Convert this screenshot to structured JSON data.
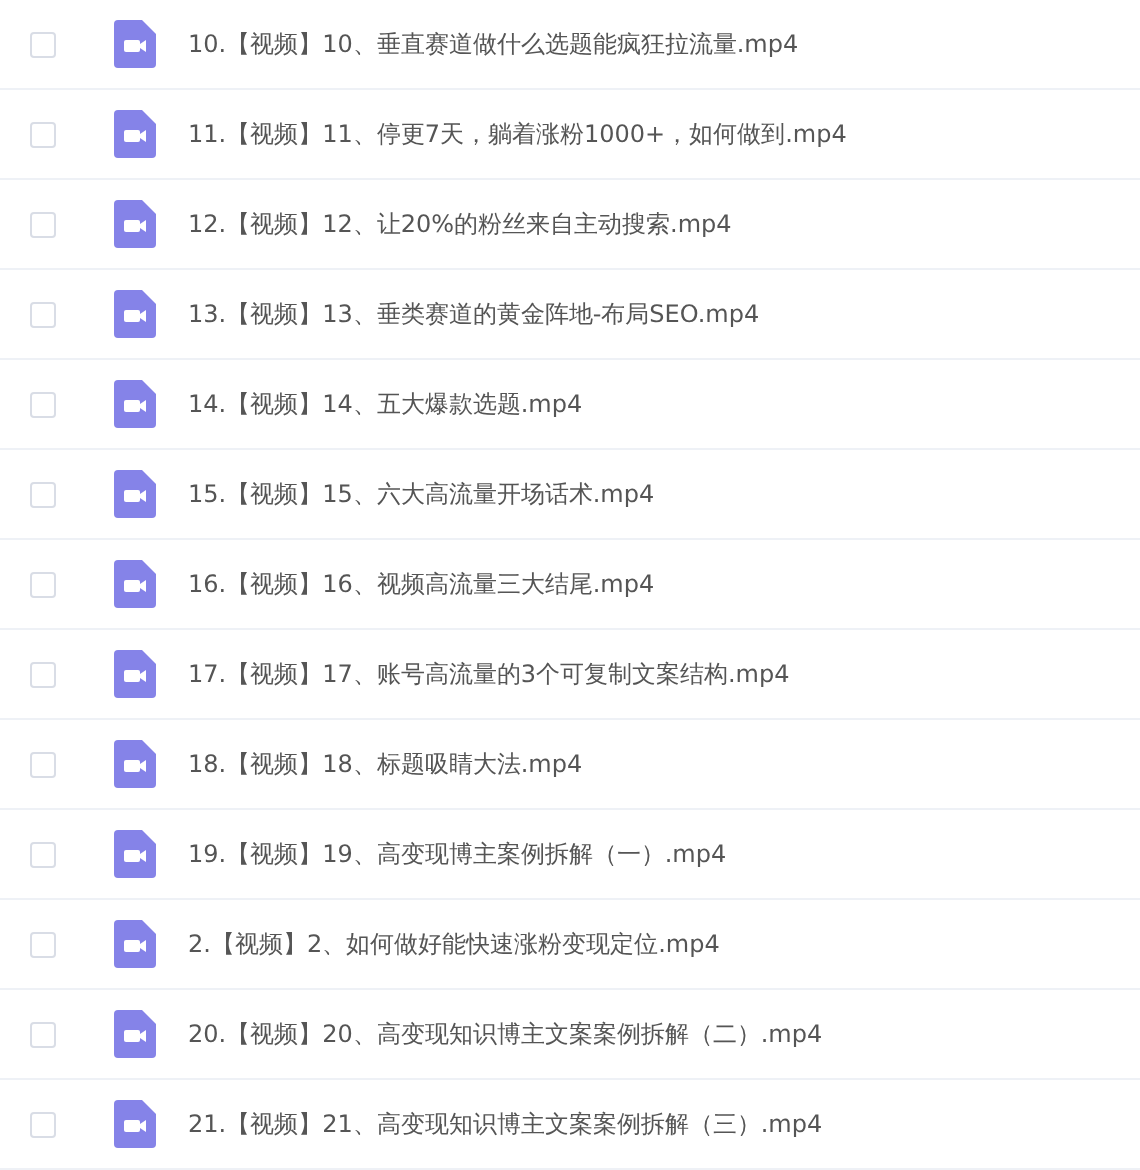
{
  "files": [
    {
      "name": "10.【视频】10、垂直赛道做什么选题能疯狂拉流量.mp4",
      "checked": false
    },
    {
      "name": "11.【视频】11、停更7天，躺着涨粉1000+，如何做到.mp4",
      "checked": false
    },
    {
      "name": "12.【视频】12、让20%的粉丝来自主动搜索.mp4",
      "checked": false
    },
    {
      "name": "13.【视频】13、垂类赛道的黄金阵地-布局SEO.mp4",
      "checked": false
    },
    {
      "name": "14.【视频】14、五大爆款选题.mp4",
      "checked": false
    },
    {
      "name": "15.【视频】15、六大高流量开场话术.mp4",
      "checked": false
    },
    {
      "name": "16.【视频】16、视频高流量三大结尾.mp4",
      "checked": false
    },
    {
      "name": "17.【视频】17、账号高流量的3个可复制文案结构.mp4",
      "checked": false
    },
    {
      "name": "18.【视频】18、标题吸睛大法.mp4",
      "checked": false
    },
    {
      "name": "19.【视频】19、高变现博主案例拆解（一）.mp4",
      "checked": false
    },
    {
      "name": "2.【视频】2、如何做好能快速涨粉变现定位.mp4",
      "checked": false
    },
    {
      "name": "20.【视频】20、高变现知识博主文案案例拆解（二）.mp4",
      "checked": false
    },
    {
      "name": "21.【视频】21、高变现知识博主文案案例拆解（三）.mp4",
      "checked": false
    }
  ]
}
